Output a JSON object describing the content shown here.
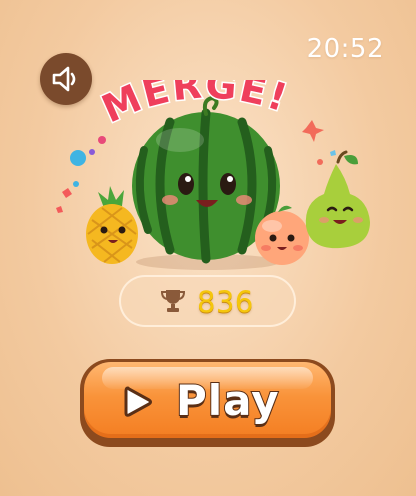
{
  "status_bar": {
    "time": "20:52"
  },
  "controls": {
    "sound_icon": "speaker-icon"
  },
  "logo": {
    "title": "MERGE!"
  },
  "score": {
    "icon": "trophy-icon",
    "value": "836"
  },
  "play_button": {
    "icon": "play-triangle-icon",
    "label": "Play"
  },
  "colors": {
    "background": "#f3caa0",
    "brand_title": "#ef3f5c",
    "score_text": "#f5c60c",
    "button_orange": "#f9933a",
    "button_outline": "#8c4a1e"
  }
}
